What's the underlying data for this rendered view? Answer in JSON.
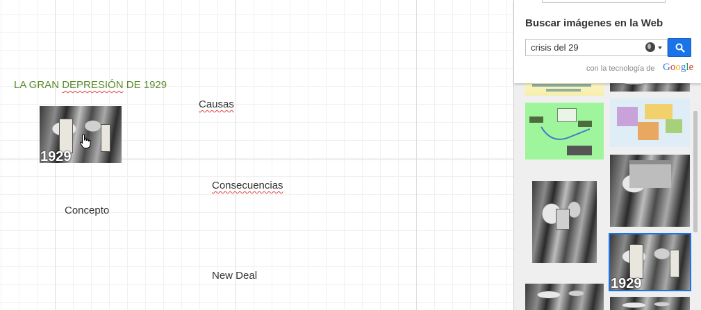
{
  "canvas": {
    "title": "LA GRAN DEPRESIÓN DE 1929",
    "title_parts": {
      "before": "LA GRAN ",
      "misspelled": "DEPRESIÓN",
      "after": " DE 1929"
    },
    "nodes": {
      "causas": "Causas",
      "consecuencias": "Consecuencias",
      "concepto": "Concepto",
      "new_deal": "New Deal"
    },
    "photo_year": "1929"
  },
  "panel": {
    "title": "Buscar imágenes en la Web",
    "search_value": "crisis del 29",
    "powered_by": "con la tecnología de",
    "google": [
      "G",
      "o",
      "o",
      "g",
      "l",
      "e"
    ],
    "google_colors": [
      "#3c78d8",
      "#d53b2a",
      "#f4b400",
      "#3c78d8",
      "#0f9d58",
      "#d53b2a"
    ],
    "selected_thumb_year": "1929"
  },
  "colors": {
    "accent": "#1a73e8",
    "title_green": "#5a8a2b"
  },
  "icons": {
    "search_button": "search-icon",
    "language": "globe-icon",
    "cursor": "hand-cursor-icon"
  }
}
